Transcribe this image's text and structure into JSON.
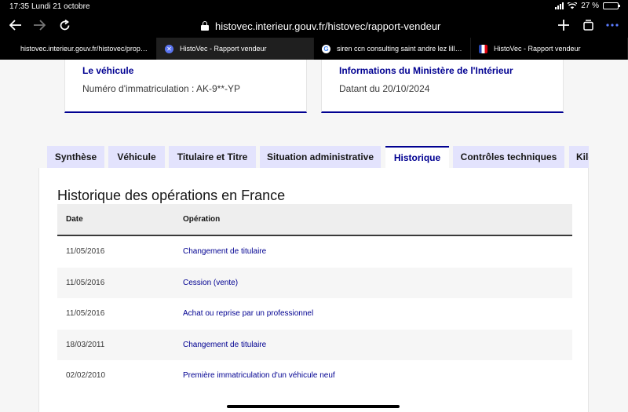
{
  "status": {
    "time": "17:35",
    "date": "Lundi 21 octobre",
    "battery": "27 %",
    "battery_level": 0.27
  },
  "browser": {
    "url": "histovec.interieur.gouv.fr/histovec/rapport-vendeur",
    "icons": {
      "back": "arrow-left-icon",
      "forward": "arrow-right-icon",
      "reload": "reload-icon",
      "lock": "lock-icon",
      "new_tab": "plus-icon",
      "tabs": "tabs-icon",
      "more": "more-icon"
    },
    "tabs": [
      {
        "title": "histovec.interieur.gouv.fr/histovec/propri...",
        "favicon": ""
      },
      {
        "title": "HistoVec - Rapport vendeur",
        "favicon": "histovec-favicon"
      },
      {
        "title": "siren ccn consulting saint andre lez lille...",
        "favicon": "google-favicon"
      },
      {
        "title": "HistoVec - Rapport vendeur",
        "favicon": "marianne-favicon"
      }
    ]
  },
  "cards": [
    {
      "title": "Le véhicule",
      "value": "Numéro d'immatriculation : AK-9**-YP"
    },
    {
      "title": "Informations du Ministère de l'Intérieur",
      "value": "Datant du 20/10/2024"
    }
  ],
  "tabs": [
    "Synthèse",
    "Véhicule",
    "Titulaire et Titre",
    "Situation administrative",
    "Historique",
    "Contrôles techniques",
    "Kilo"
  ],
  "active_tab": "Historique",
  "history": {
    "title": "Historique des opérations en France",
    "columns": [
      "Date",
      "Opération"
    ],
    "rows": [
      {
        "date": "11/05/2016",
        "operation": "Changement de titulaire"
      },
      {
        "date": "11/05/2016",
        "operation": "Cession (vente)"
      },
      {
        "date": "11/05/2016",
        "operation": "Achat ou reprise par un professionnel"
      },
      {
        "date": "18/03/2011",
        "operation": "Changement de titulaire"
      },
      {
        "date": "02/02/2010",
        "operation": "Première immatriculation d'un véhicule neuf"
      }
    ]
  },
  "colors": {
    "primary": "#000091",
    "tab_bg": "#e3e3fd",
    "header_bg": "#eeeeee"
  }
}
